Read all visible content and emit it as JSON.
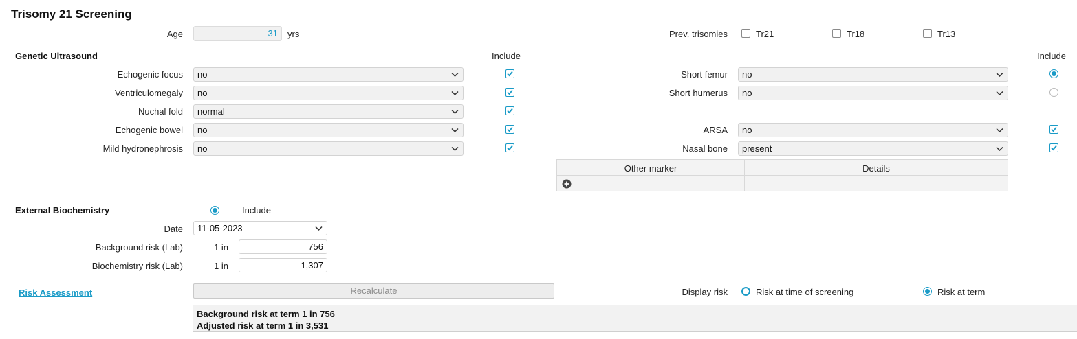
{
  "title": "Trisomy 21 Screening",
  "age": {
    "label": "Age",
    "value": "31",
    "unit": "yrs"
  },
  "prev_trisomies": {
    "label": "Prev. trisomies",
    "options": [
      {
        "label": "Tr21",
        "checked": false
      },
      {
        "label": "Tr18",
        "checked": false
      },
      {
        "label": "Tr13",
        "checked": false
      }
    ]
  },
  "genetic_ultrasound": {
    "heading": "Genetic Ultrasound",
    "include_header": "Include",
    "left_markers": [
      {
        "label": "Echogenic focus",
        "value": "no",
        "included": true
      },
      {
        "label": "Ventriculomegaly",
        "value": "no",
        "included": true
      },
      {
        "label": "Nuchal fold",
        "value": "normal",
        "included": true
      },
      {
        "label": "Echogenic bowel",
        "value": "no",
        "included": true
      },
      {
        "label": "Mild hydronephrosis",
        "value": "no",
        "included": true
      }
    ],
    "right_markers": [
      {
        "label": "Short femur",
        "value": "no",
        "include_type": "radio",
        "included": true
      },
      {
        "label": "Short humerus",
        "value": "no",
        "include_type": "radio",
        "included": false
      },
      {
        "label": "ARSA",
        "value": "no",
        "include_type": "checkbox",
        "included": true
      },
      {
        "label": "Nasal bone",
        "value": "present",
        "include_type": "checkbox",
        "included": true
      }
    ],
    "other_markers_table": {
      "columns": [
        "Other marker",
        "Details"
      ]
    }
  },
  "external_biochemistry": {
    "heading": "External Biochemistry",
    "include_label": "Include",
    "include_selected": true,
    "date": {
      "label": "Date",
      "value": "11-05-2023"
    },
    "background_risk": {
      "label": "Background risk (Lab)",
      "prefix": "1 in",
      "value": "756"
    },
    "biochemistry_risk": {
      "label": "Biochemistry risk (Lab)",
      "prefix": "1 in",
      "value": "1,307"
    }
  },
  "risk_assessment": {
    "link": "Risk Assessment",
    "recalculate_label": "Recalculate",
    "display_risk_label": "Display risk",
    "display_options": [
      {
        "label": "Risk at time of screening",
        "selected": false
      },
      {
        "label": "Risk at term",
        "selected": true
      }
    ],
    "results": [
      "Background risk at term 1 in 756",
      "Adjusted risk at term 1 in 3,531"
    ]
  },
  "colors": {
    "accent": "#1a9bc7",
    "field_bg": "#f1f1f1",
    "border": "#d3d3d3"
  }
}
